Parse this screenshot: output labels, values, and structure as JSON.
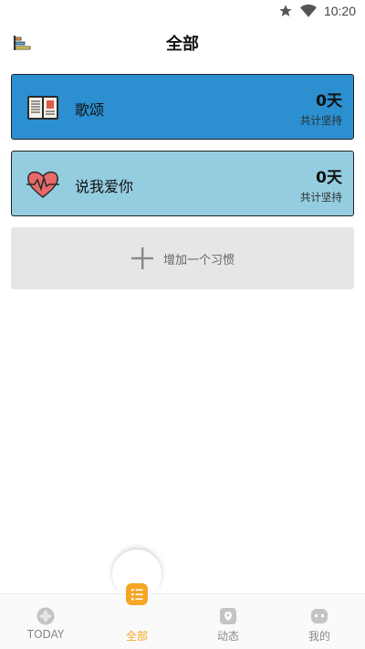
{
  "status_bar": {
    "time": "10:20"
  },
  "header": {
    "title": "全部"
  },
  "habits": [
    {
      "name": "歌颂",
      "days": "0天",
      "caption": "共计坚持",
      "color": "#2b8fd0",
      "icon": "book-icon"
    },
    {
      "name": "说我爱你",
      "days": "0天",
      "caption": "共计坚持",
      "color": "#95cde0",
      "icon": "heartbeat-icon"
    }
  ],
  "add_habit": {
    "label": "增加一个习惯",
    "icon": "plus-icon"
  },
  "bottom_nav": {
    "items": [
      {
        "label": "TODAY",
        "icon": "clover-icon"
      },
      {
        "label": "全部",
        "icon": "checklist-icon",
        "active": true
      },
      {
        "label": "动态",
        "icon": "feed-icon"
      },
      {
        "label": "我的",
        "icon": "profile-icon"
      }
    ],
    "active_color": "#f5a623"
  }
}
